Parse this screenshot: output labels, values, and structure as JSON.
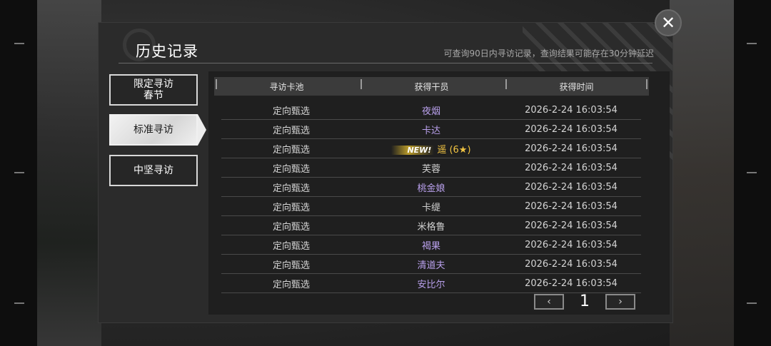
{
  "window": {
    "title": "历史记录",
    "subtitle": "可查询90日内寻访记录，查询结果可能存在30分钟延迟",
    "close_label": "✕"
  },
  "tabs": [
    {
      "label": "限定寻访\n春节",
      "active": false
    },
    {
      "label": "标准寻访",
      "active": true
    },
    {
      "label": "中坚寻访",
      "active": false
    }
  ],
  "table": {
    "headers": [
      "寻访卡池",
      "获得干员",
      "获得时间"
    ],
    "rows": [
      {
        "pool": "定向甄选",
        "operator": "夜烟",
        "time": "2026-2-24 16:03:54",
        "rarity": "4"
      },
      {
        "pool": "定向甄选",
        "operator": "卡达",
        "time": "2026-2-24 16:03:54",
        "rarity": "4"
      },
      {
        "pool": "定向甄选",
        "operator": "遥 (6★)",
        "time": "2026-2-24 16:03:54",
        "rarity": "6",
        "badge": "NEW!"
      },
      {
        "pool": "定向甄选",
        "operator": "芙蓉",
        "time": "2026-2-24 16:03:54",
        "rarity": "3"
      },
      {
        "pool": "定向甄选",
        "operator": "桃金娘",
        "time": "2026-2-24 16:03:54",
        "rarity": "4"
      },
      {
        "pool": "定向甄选",
        "operator": "卡缇",
        "time": "2026-2-24 16:03:54",
        "rarity": "3"
      },
      {
        "pool": "定向甄选",
        "operator": "米格鲁",
        "time": "2026-2-24 16:03:54",
        "rarity": "3"
      },
      {
        "pool": "定向甄选",
        "operator": "褐果",
        "time": "2026-2-24 16:03:54",
        "rarity": "4"
      },
      {
        "pool": "定向甄选",
        "operator": "清道夫",
        "time": "2026-2-24 16:03:54",
        "rarity": "4"
      },
      {
        "pool": "定向甄选",
        "operator": "安比尔",
        "time": "2026-2-24 16:03:54",
        "rarity": "4"
      }
    ]
  },
  "pager": {
    "prev_label": "‹",
    "next_label": "›",
    "page": "1"
  },
  "colors": {
    "rarity4": "#b9a0ec",
    "rarity6": "#f2c442",
    "rarity3": "#cfcfcf"
  }
}
